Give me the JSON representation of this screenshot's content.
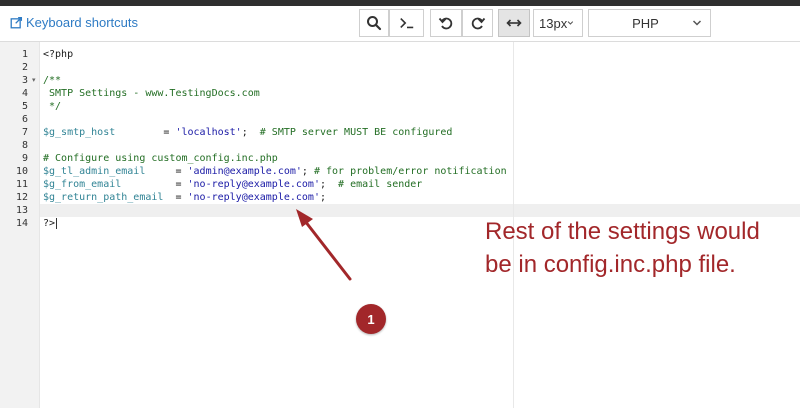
{
  "toolbar": {
    "keyboard_shortcuts_label": "Keyboard shortcuts",
    "font_size": "13px",
    "language": "PHP",
    "buttons": [
      {
        "icon": "search-icon"
      },
      {
        "icon": "terminal-icon"
      },
      {
        "icon": "undo-icon"
      },
      {
        "icon": "redo-icon"
      },
      {
        "icon": "wrap-toggle-icon",
        "active": true
      }
    ]
  },
  "editor": {
    "active_line": 14,
    "fold_markers": [
      3
    ],
    "lines": [
      {
        "n": "1",
        "text": "<?php"
      },
      {
        "n": "2",
        "text": ""
      },
      {
        "n": "3",
        "text": "/**"
      },
      {
        "n": "4",
        "text": " SMTP Settings - www.TestingDocs.com"
      },
      {
        "n": "5",
        "text": " */"
      },
      {
        "n": "6",
        "text": ""
      },
      {
        "n": "7",
        "var": "$g_smtp_host",
        "pad": "        = ",
        "str": "'localhost'",
        "rest": ";  ",
        "cmt": "# SMTP server MUST BE configured"
      },
      {
        "n": "8",
        "text": ""
      },
      {
        "n": "9",
        "text": "# Configure using custom_config.inc.php"
      },
      {
        "n": "10",
        "var": "$g_tl_admin_email",
        "pad": "     = ",
        "str": "'admin@example.com'",
        "rest": "; ",
        "cmt": "# for problem/error notification"
      },
      {
        "n": "11",
        "var": "$g_from_email",
        "pad": "         = ",
        "str": "'no-reply@example.com'",
        "rest": ";  ",
        "cmt": "# email sender"
      },
      {
        "n": "12",
        "var": "$g_return_path_email",
        "pad": "  = ",
        "str": "'no-reply@example.com'",
        "rest": ";",
        "cmt": ""
      },
      {
        "n": "13",
        "text": ""
      },
      {
        "n": "14",
        "text": "?>"
      }
    ]
  },
  "annotation": {
    "text": "Rest of the settings would be in config.inc.php file.",
    "badge": "1",
    "color": "#a2272a"
  }
}
